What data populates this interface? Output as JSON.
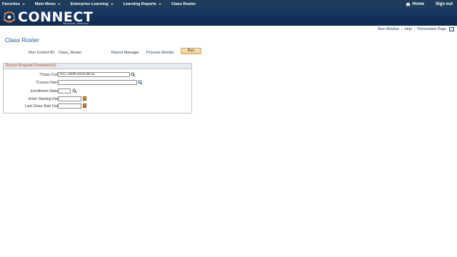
{
  "nav": {
    "items": [
      "Favorites",
      "Main Menu",
      "Enterprise Learning",
      "Learning Reports",
      "Class Roster"
    ],
    "home_label": "Home",
    "signout_label": "Sign out"
  },
  "header": {
    "brand": "CONNECT",
    "tagline": "Maryland Judiciary"
  },
  "page_links": {
    "new_window": "New Window",
    "help": "Help",
    "personalize": "Personalize Page",
    "separator": "|"
  },
  "page": {
    "title": "Class Roster"
  },
  "run_control": {
    "label": "Run Control ID:",
    "value": "Class_Roster",
    "report_manager": "Report Manager",
    "process_monitor": "Process Monitor",
    "run_button": "Run"
  },
  "parameters": {
    "title": "Report Request Parameter(s)",
    "fields": {
      "class_code": {
        "label": "*Class Code",
        "value": "TEC-1004-2015-08-31"
      },
      "course_name": {
        "label": "*Course Name",
        "value": ""
      },
      "enrollment_status": {
        "label": "Enrollment Status",
        "value": ""
      },
      "start_date": {
        "label": "Enter Starting Date",
        "value": ""
      },
      "last_class_start": {
        "label": "Last Class Start Date",
        "value": ""
      }
    }
  },
  "colors": {
    "nav_bg": "#1f3c5b",
    "header_bg": "#1a3a66",
    "title_blue": "#1f5a96",
    "groupbox_title": "#b24a1a",
    "run_button": "#f3cf8b"
  },
  "icons": [
    "home-icon",
    "lookup-icon",
    "calendar-icon",
    "customize-icon"
  ]
}
